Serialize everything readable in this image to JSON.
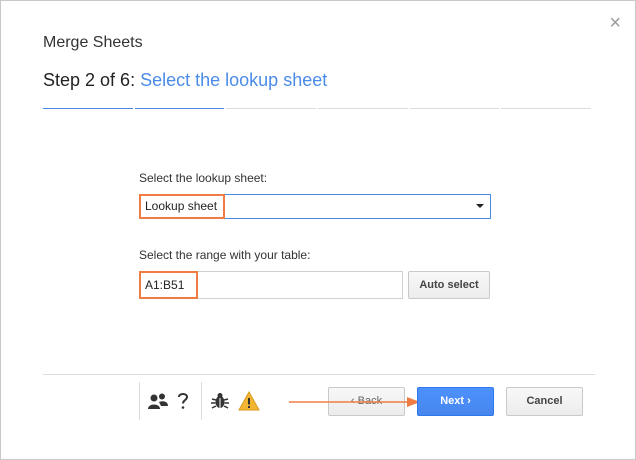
{
  "dialog": {
    "title": "Merge Sheets",
    "close_label": "×",
    "step_prefix": "Step 2 of 6:",
    "step_name": "Select the lookup sheet",
    "progress": {
      "total_steps": 6,
      "current_step": 2
    }
  },
  "lookup_sheet": {
    "label": "Select the lookup sheet:",
    "selected": "Lookup sheet"
  },
  "range": {
    "label": "Select the range with your table:",
    "value": "A1:B51",
    "auto_select_label": "Auto select"
  },
  "footer": {
    "back_label": "Back",
    "next_label": "Next",
    "cancel_label": "Cancel",
    "back_chevron": "‹",
    "next_chevron": "›"
  },
  "colors": {
    "accent": "#4a8be8",
    "highlight": "#ef7d43",
    "warning": "#f2b632"
  }
}
